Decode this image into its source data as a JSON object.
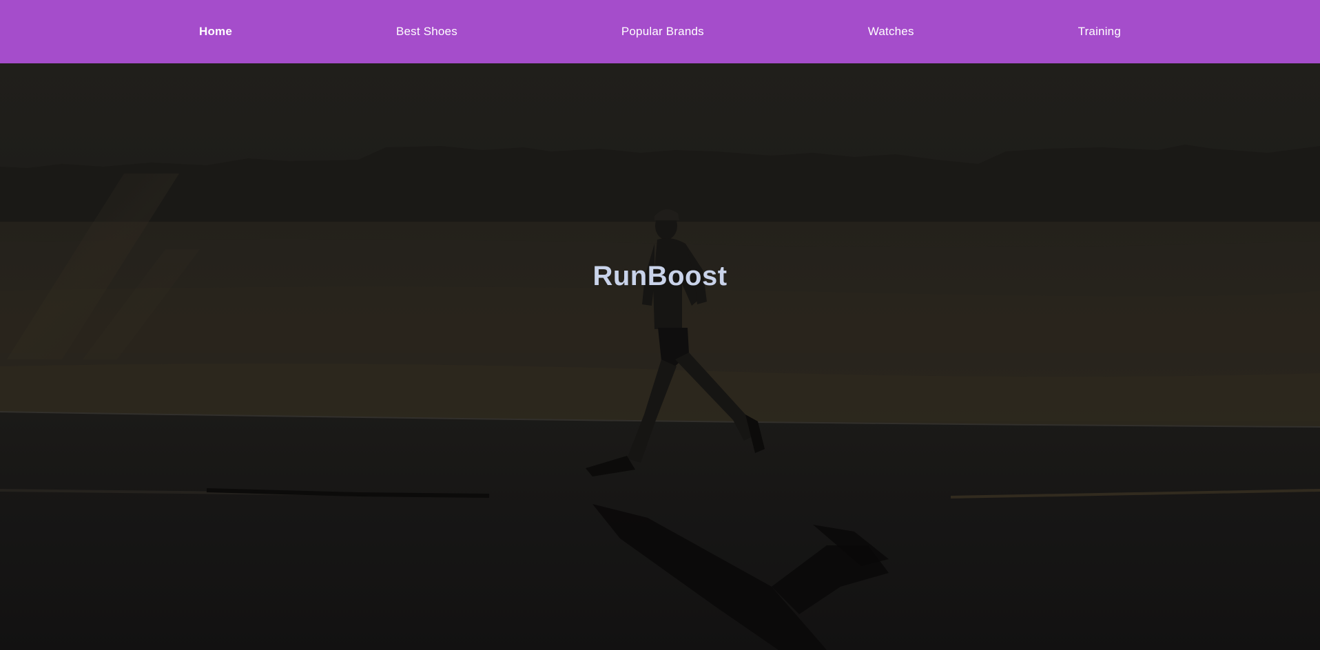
{
  "nav": {
    "items": [
      {
        "label": "Home",
        "active": true
      },
      {
        "label": "Best Shoes",
        "active": false
      },
      {
        "label": "Popular Brands",
        "active": false
      },
      {
        "label": "Watches",
        "active": false
      },
      {
        "label": "Training",
        "active": false
      }
    ],
    "background_color": "#a54dcb",
    "text_color": "#ffffff"
  },
  "hero": {
    "title": "RunBoost",
    "title_color": "#c9d3ea",
    "image_subject": "runner-on-desert-road-photo"
  }
}
